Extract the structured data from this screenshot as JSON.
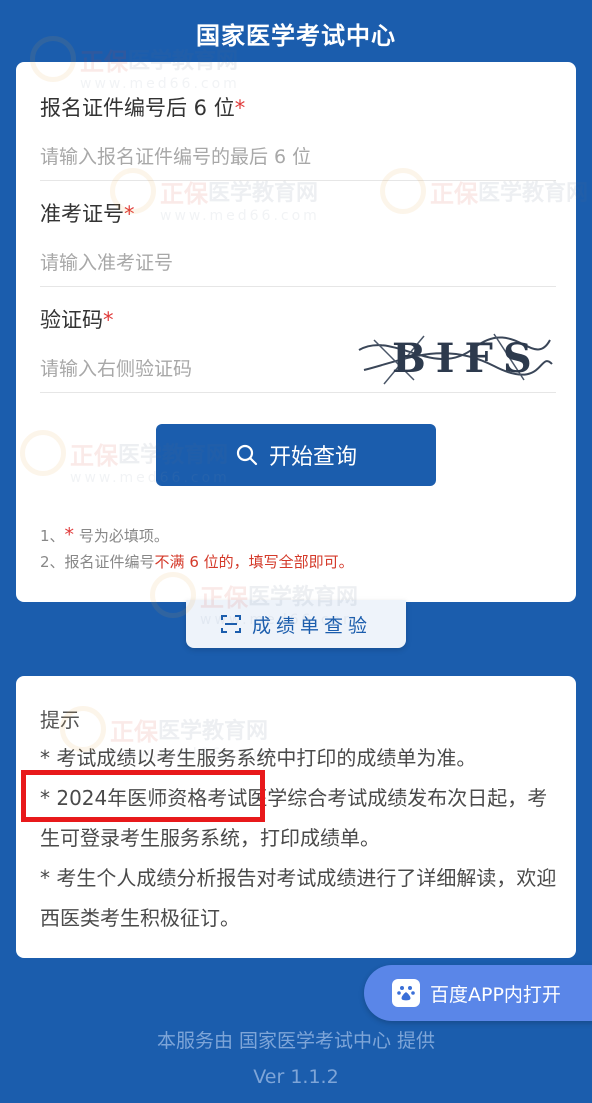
{
  "header": {
    "title": "国家医学考试中心"
  },
  "form": {
    "id_field": {
      "label": "报名证件编号后 6 位",
      "required_mark": "*",
      "placeholder": "请输入报名证件编号的最后 6 位"
    },
    "exam_no_field": {
      "label": "准考证号",
      "required_mark": "*",
      "placeholder": "请输入准考证号"
    },
    "captcha_field": {
      "label": "验证码",
      "required_mark": "*",
      "placeholder": "请输入右侧验证码",
      "captcha_text": "BIFS"
    },
    "query_button": "开始查询",
    "notes": {
      "line1_prefix": "1、",
      "line1_star": "*",
      "line1_text": " 号为必填项。",
      "line2_prefix": "2、报名证件编号",
      "line2_red": "不满 6 位的，填写全部即可。"
    }
  },
  "report_button": "成绩单查验",
  "tips": {
    "title": "提示",
    "items": [
      "* 考试成绩以考生服务系统中打印的成绩单为准。",
      "* 2024年医师资格考试医学综合考试成绩发布次日起，考生可登录考生服务系统，打印成绩单。",
      "* 考生个人成绩分析报告对考试成绩进行了详细解读，欢迎西医类考生积极征订。"
    ]
  },
  "baidu_button": "百度APP内打开",
  "footer": {
    "provider": "本服务由 国家医学考试中心 提供",
    "version": "Ver 1.1.2"
  },
  "watermark": {
    "brand": "正保",
    "name": "医学教育网",
    "url": "www.med66.com"
  },
  "colors": {
    "primary": "#1b5dad",
    "required": "#e03a3a",
    "highlight_box": "#e8191b",
    "baidu": "#5a86e8"
  }
}
